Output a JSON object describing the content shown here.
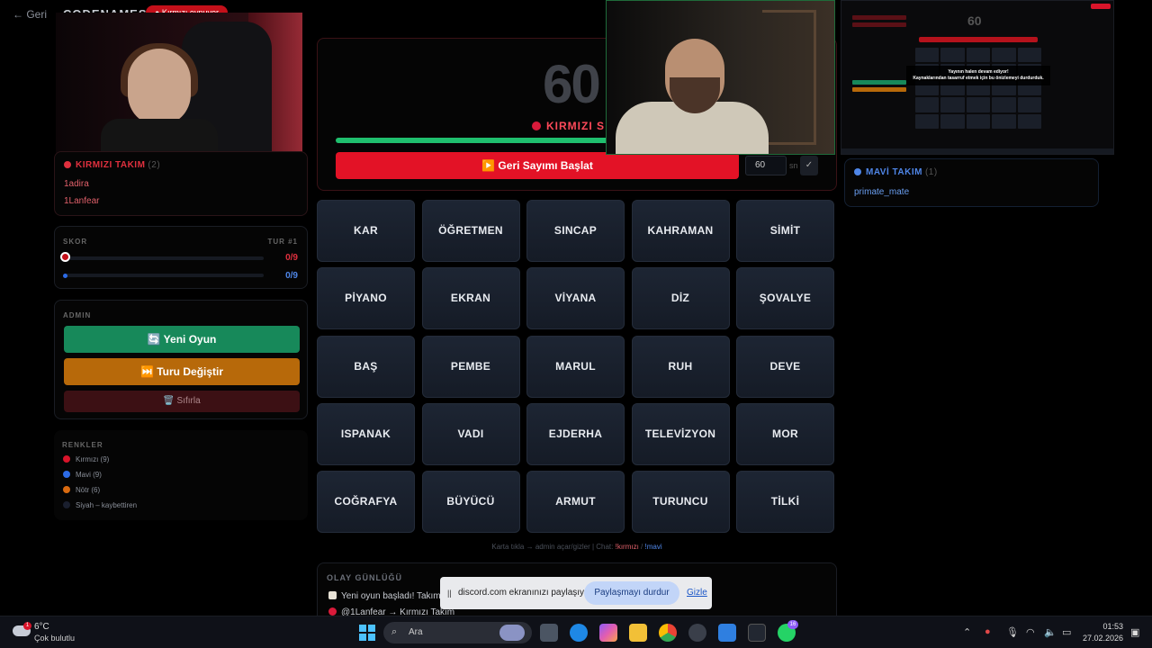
{
  "header": {
    "back": "← Geri",
    "brand": "CODENAMES",
    "turn_pill": "● Kırmızı oynuyor"
  },
  "red_team": {
    "title": "KIRMIZI TAKIM",
    "count": "(2)",
    "members": [
      "1adira",
      "1Lanfear"
    ],
    "color": "#e0303e"
  },
  "score": {
    "label": "SKOR",
    "round": "TUR #1",
    "red": {
      "value": "0/9",
      "fraction": 0
    },
    "blue": {
      "value": "0/9",
      "fraction": 0
    }
  },
  "admin": {
    "label": "ADMIN",
    "new_game": "🔄 Yeni Oyun",
    "switch_turn": "⏭️ Turu Değiştir",
    "reset": "🗑️ Sıfırla"
  },
  "colors": {
    "label": "RENKLER",
    "items": [
      {
        "label": "Kırmızı (9)",
        "color": "#d9142a"
      },
      {
        "label": "Mavi (9)",
        "color": "#2c6be6"
      },
      {
        "label": "Nötr (6)",
        "color": "#d96a10"
      },
      {
        "label": "Siyah – kaybettiren",
        "color": "#1a1f2e"
      }
    ]
  },
  "timer": {
    "seconds": "60",
    "turn_label": "KIRMIZI S",
    "progress": 1.0,
    "start_button": "▶️ Geri Sayımı Başlat",
    "duration_value": "60",
    "unit": "sn",
    "confirm": "✓"
  },
  "blue_team": {
    "title": "MAVİ TAKIM",
    "count": "(1)",
    "members": [
      "primate_mate"
    ],
    "color": "#4f86e8"
  },
  "board": {
    "words": [
      "KAR",
      "ÖĞRETMEN",
      "SINCAP",
      "KAHRAMAN",
      "SİMİT",
      "PİYANO",
      "EKRAN",
      "VİYANA",
      "DİZ",
      "ŞOVALYE",
      "BAŞ",
      "PEMBE",
      "MARUL",
      "RUH",
      "DEVE",
      "ISPANAK",
      "VADI",
      "EJDERHA",
      "TELEVİZYON",
      "MOR",
      "COĞRAFYA",
      "BÜYÜCÜ",
      "ARMUT",
      "TURUNCU",
      "TİLKİ"
    ]
  },
  "hint": {
    "text": "Karta tıkla → admin açar/gizler  |  Chat: ",
    "red_cmd": "!kırmızı",
    "sep": " / ",
    "blue_cmd": "!mavi"
  },
  "log": {
    "title": "OLAY GÜNLÜĞÜ",
    "lines": [
      "Yeni oyun başladı! Takım s",
      "@1Lanfear → Kırmızı Takım"
    ]
  },
  "share_bar": {
    "pause": "||",
    "message": "discord.com ekranınızı paylaşıyor.",
    "stop": "Paylaşmayı durdur",
    "hide": "Gizle"
  },
  "taskbar": {
    "temp": "6°C",
    "weather_badge": "1",
    "weather": "Çok bulutlu",
    "search": "Ara",
    "whatsapp_badge": "16",
    "time": "01:53",
    "date": "27.02.2026"
  },
  "stream_preview": {
    "number": "60",
    "message_line1": "Yayının halen devam ediyor!",
    "message_line2": "Kaynaklarından tasarruf etmek için bu önizlemeyi durdurduk."
  }
}
